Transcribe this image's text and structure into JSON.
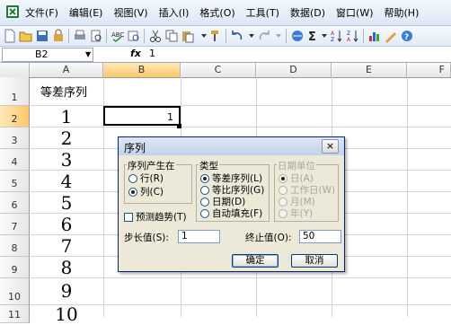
{
  "menu": {
    "items": [
      "文件(F)",
      "编辑(E)",
      "视图(V)",
      "插入(I)",
      "格式(O)",
      "工具(T)",
      "数据(D)",
      "窗口(W)",
      "帮助(H)"
    ]
  },
  "formula_bar": {
    "name_box": "B2",
    "fx": "fx",
    "value": "1"
  },
  "columns": [
    "A",
    "B",
    "C",
    "D",
    "E",
    "F"
  ],
  "rows": [
    "1",
    "2",
    "3",
    "4",
    "5",
    "6",
    "7",
    "8",
    "9",
    "10",
    "11"
  ],
  "sheet": {
    "title": "等差序列",
    "a_values": [
      "1",
      "2",
      "3",
      "4",
      "5",
      "6",
      "7",
      "8",
      "9",
      "10"
    ],
    "b2_value": "1"
  },
  "dialog": {
    "title": "序列",
    "close": "×",
    "series_in": {
      "title": "序列产生在",
      "options": [
        "行(R)",
        "列(C)"
      ],
      "selected": "列(C)"
    },
    "type": {
      "title": "类型",
      "options": [
        "等差序列(L)",
        "等比序列(G)",
        "日期(D)",
        "自动填充(F)"
      ],
      "selected": "等差序列(L)"
    },
    "date_unit": {
      "title": "日期单位",
      "options": [
        "日(A)",
        "工作日(W)",
        "月(M)",
        "年(Y)"
      ],
      "selected": "日(A)"
    },
    "trend_label": "预测趋势(T)",
    "step_label": "步长值(S):",
    "step_value": "1",
    "stop_label": "终止值(O):",
    "stop_value": "50",
    "ok_label": "确定",
    "cancel_label": "取消"
  }
}
